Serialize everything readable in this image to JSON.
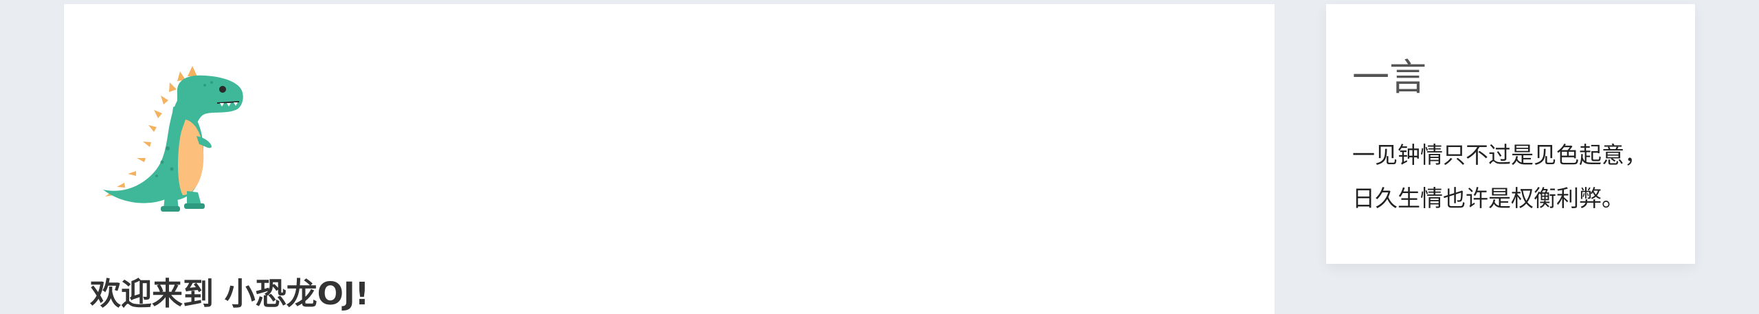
{
  "main": {
    "welcome_text": "欢迎来到 小恐龙OJ!",
    "mascot_icon": "dinosaur-icon"
  },
  "sidebar_card": {
    "title": "一言",
    "quote_lines": [
      "一见钟情只不过是见色起意，",
      "日久生情也许是权衡利弊。"
    ]
  },
  "colors": {
    "background": "#e9edf1",
    "card": "#ffffff",
    "dino_body": "#3fb89a",
    "dino_belly": "#fcc07c",
    "dino_spikes": "#f4b15e"
  }
}
